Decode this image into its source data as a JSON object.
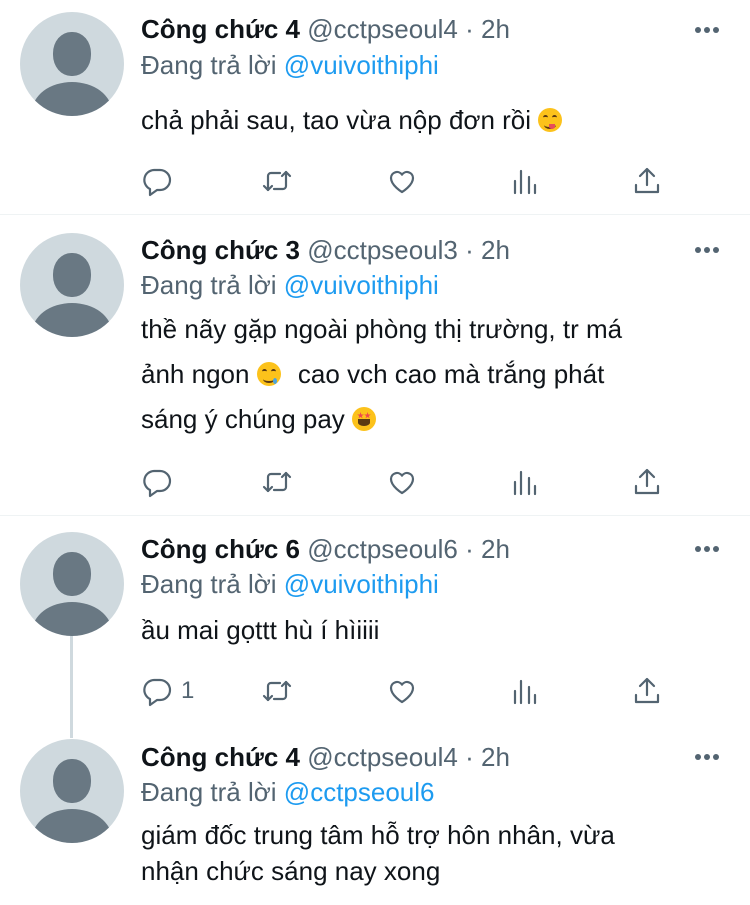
{
  "tweets": [
    {
      "name": "Công chức 4",
      "handle": "@cctpseoul4",
      "sep": "·",
      "time": "2h",
      "reply_prefix": "Đang trả lời",
      "reply_to": "@vuivoithiphi",
      "lines": [
        "chả phải sau, tao vừa nộp đơn rồi"
      ],
      "reply_count": ""
    },
    {
      "name": "Công chức 3",
      "handle": "@cctpseoul3",
      "sep": "·",
      "time": "2h",
      "reply_prefix": "Đang trả lời",
      "reply_to": "@vuivoithiphi",
      "lines": [
        "thề nãy gặp ngoài phòng thị trường, tr má",
        "ảnh ngon",
        "cao vch cao mà trắng phát",
        "sáng ý chúng pay"
      ],
      "reply_count": ""
    },
    {
      "name": "Công chức 6",
      "handle": "@cctpseoul6",
      "sep": "·",
      "time": "2h",
      "reply_prefix": "Đang trả lời",
      "reply_to": "@vuivoithiphi",
      "lines": [
        "ầu mai gọttt hù í hìiiii"
      ],
      "reply_count": "1"
    },
    {
      "name": "Công chức 4",
      "handle": "@cctpseoul4",
      "sep": "·",
      "time": "2h",
      "reply_prefix": "Đang trả lời",
      "reply_to": "@cctpseoul6",
      "lines": [
        "giám đốc trung tâm hỗ trợ hôn nhân, vừa",
        "nhận chức sáng nay xong"
      ],
      "reply_count": ""
    }
  ],
  "icons": {
    "reply": "reply-icon",
    "retweet": "retweet-icon",
    "like": "like-icon",
    "stats": "stats-icon",
    "share": "share-icon",
    "more": "more-icon",
    "emoji_1": "face-savoring-food-emoji",
    "emoji_2": "drooling-face-emoji",
    "emoji_3": "star-struck-emoji"
  },
  "colors": {
    "link": "#1d9bf0",
    "secondary": "#536471",
    "avatar_bg": "#cfd9de",
    "avatar_fg": "#697883"
  }
}
